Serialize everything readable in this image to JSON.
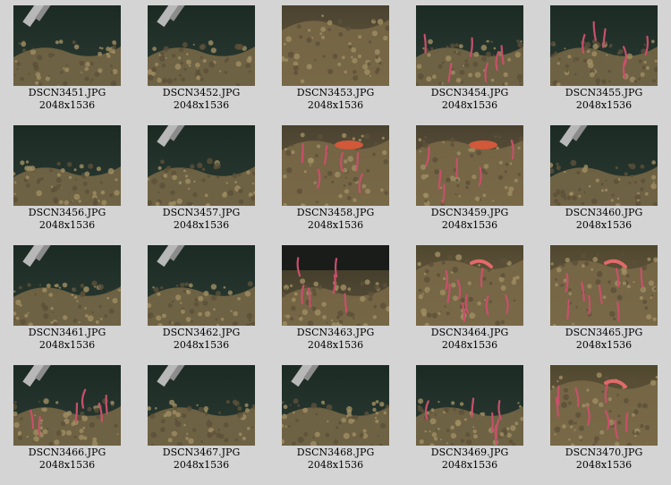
{
  "gallery": {
    "items": [
      {
        "filename": "DSCN3451.JPG",
        "dimensions": "2048x1536",
        "scene": "claw-branch"
      },
      {
        "filename": "DSCN3452.JPG",
        "dimensions": "2048x1536",
        "scene": "claw-branch"
      },
      {
        "filename": "DSCN3453.JPG",
        "dimensions": "2048x1536",
        "scene": "moss"
      },
      {
        "filename": "DSCN3454.JPG",
        "dimensions": "2048x1536",
        "scene": "worms-dark"
      },
      {
        "filename": "DSCN3455.JPG",
        "dimensions": "2048x1536",
        "scene": "worms-dark"
      },
      {
        "filename": "DSCN3456.JPG",
        "dimensions": "2048x1536",
        "scene": "dark-branch"
      },
      {
        "filename": "DSCN3457.JPG",
        "dimensions": "2048x1536",
        "scene": "claw-branch"
      },
      {
        "filename": "DSCN3458.JPG",
        "dimensions": "2048x1536",
        "scene": "moss-shrimp"
      },
      {
        "filename": "DSCN3459.JPG",
        "dimensions": "2048x1536",
        "scene": "moss-shrimp"
      },
      {
        "filename": "DSCN3460.JPG",
        "dimensions": "2048x1536",
        "scene": "claw-branch"
      },
      {
        "filename": "DSCN3461.JPG",
        "dimensions": "2048x1536",
        "scene": "claw-branch"
      },
      {
        "filename": "DSCN3462.JPG",
        "dimensions": "2048x1536",
        "scene": "claw-branch"
      },
      {
        "filename": "DSCN3463.JPG",
        "dimensions": "2048x1536",
        "scene": "moss-dark-top"
      },
      {
        "filename": "DSCN3464.JPG",
        "dimensions": "2048x1536",
        "scene": "worms-bright"
      },
      {
        "filename": "DSCN3465.JPG",
        "dimensions": "2048x1536",
        "scene": "worms-bright"
      },
      {
        "filename": "DSCN3466.JPG",
        "dimensions": "2048x1536",
        "scene": "claw-worms"
      },
      {
        "filename": "DSCN3467.JPG",
        "dimensions": "2048x1536",
        "scene": "claw-branch"
      },
      {
        "filename": "DSCN3468.JPG",
        "dimensions": "2048x1536",
        "scene": "claw-branch"
      },
      {
        "filename": "DSCN3469.JPG",
        "dimensions": "2048x1536",
        "scene": "worms-dark"
      },
      {
        "filename": "DSCN3470.JPG",
        "dimensions": "2048x1536",
        "scene": "worms-bright"
      }
    ]
  },
  "colors": {
    "page_background": "#d4d4d4",
    "caption_text": "#000000"
  }
}
